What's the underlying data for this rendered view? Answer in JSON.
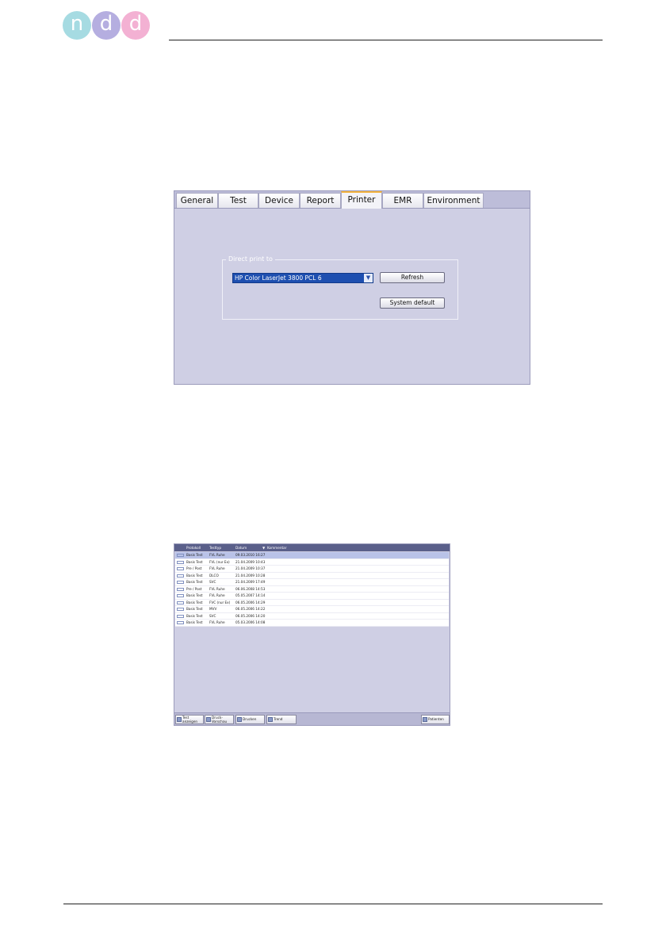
{
  "logo": {
    "letters": [
      "n",
      "d",
      "d"
    ],
    "colors": [
      "#a6dbe2",
      "#b5aee0",
      "#f3b1d3"
    ]
  },
  "settings": {
    "tabs": [
      {
        "label": "General",
        "active": false
      },
      {
        "label": "Test",
        "active": false
      },
      {
        "label": "Device",
        "active": false
      },
      {
        "label": "Report",
        "active": false
      },
      {
        "label": "Printer",
        "active": true
      },
      {
        "label": "EMR",
        "active": false
      },
      {
        "label": "Environment",
        "active": false
      }
    ],
    "printer": {
      "group_label": "Direct print to",
      "selected_printer": "HP Color LaserJet 3800 PCL 6",
      "refresh_label": "Refresh",
      "system_default_label": "System default"
    }
  },
  "patient_list": {
    "columns": [
      "Protokoll",
      "Testtyp",
      "Datum",
      "Kommentar"
    ],
    "rows": [
      {
        "protocol": "Basis Test",
        "type": "FVL Ruhe",
        "date": "09.03.2010 16:27",
        "selected": true
      },
      {
        "protocol": "Basis Test",
        "type": "FVL (nur Ex)",
        "date": "21.04.2009 10:43",
        "selected": false
      },
      {
        "protocol": "Pre / Post",
        "type": "FVL Ruhe",
        "date": "21.04.2009 10:37",
        "selected": false
      },
      {
        "protocol": "Basis Test",
        "type": "DLCO",
        "date": "21.04.2009 10:28",
        "selected": false
      },
      {
        "protocol": "Basis Test",
        "type": "SVC",
        "date": "21.04.2009 17:49",
        "selected": false
      },
      {
        "protocol": "Pre / Post",
        "type": "FVL Ruhe",
        "date": "06.06.2008 14:53",
        "selected": false
      },
      {
        "protocol": "Basis Test",
        "type": "FVL Ruhe",
        "date": "05.05.2007 14:14",
        "selected": false
      },
      {
        "protocol": "Basis Test",
        "type": "FVC (nur Ex)",
        "date": "06.05.2006 14:29",
        "selected": false
      },
      {
        "protocol": "Basis Test",
        "type": "MVV",
        "date": "06.05.2006 14:22",
        "selected": false
      },
      {
        "protocol": "Basis Test",
        "type": "SVC",
        "date": "06.05.2006 14:20",
        "selected": false
      },
      {
        "protocol": "Basis Test",
        "type": "FVL Ruhe",
        "date": "05.03.2006 14:08",
        "selected": false
      }
    ],
    "footer_buttons": {
      "test_anzeigen": [
        "Test",
        "anzeigen"
      ],
      "druck_vorschau": [
        "Druck-",
        "Vorschau"
      ],
      "drucken": "Drucken",
      "trend": "Trend",
      "patienten": "Patienten"
    }
  }
}
